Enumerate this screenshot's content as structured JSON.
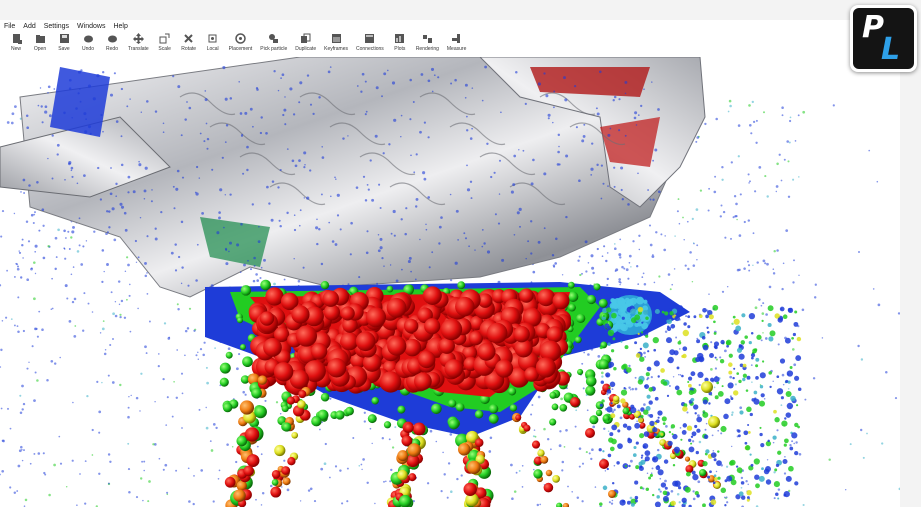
{
  "menu": [
    "File",
    "Add",
    "Settings",
    "Windows",
    "Help"
  ],
  "toolbar": [
    {
      "label": "New",
      "icon": "new-icon"
    },
    {
      "label": "Open",
      "icon": "open-icon"
    },
    {
      "label": "Save",
      "icon": "save-icon"
    },
    {
      "label": "Undo",
      "icon": "undo-icon"
    },
    {
      "label": "Redo",
      "icon": "redo-icon"
    },
    {
      "label": "Translate",
      "icon": "translate-icon"
    },
    {
      "label": "Scale",
      "icon": "scale-icon"
    },
    {
      "label": "Rotate",
      "icon": "rotate-icon"
    },
    {
      "label": "Local",
      "icon": "local-icon"
    },
    {
      "label": "Placement",
      "icon": "placement-icon"
    },
    {
      "label": "Pick particle",
      "icon": "pick-particle-icon"
    },
    {
      "label": "Duplicate",
      "icon": "duplicate-icon"
    },
    {
      "label": "Keyframes",
      "icon": "keyframes-icon"
    },
    {
      "label": "Connections",
      "icon": "connections-icon"
    },
    {
      "label": "Plots",
      "icon": "plots-icon"
    },
    {
      "label": "Rendering",
      "icon": "rendering-icon"
    },
    {
      "label": "Measure",
      "icon": "measure-icon"
    }
  ],
  "logo": {
    "letters": [
      "P",
      "L"
    ],
    "colors": {
      "p": "#ffffff",
      "l": "#2ea0e8",
      "bg": "#141414"
    }
  },
  "viewport": {
    "content": "particle-simulation-render",
    "colors": {
      "blue": "#1e3cd8",
      "green": "#22cc22",
      "red": "#e01010",
      "yellow": "#dde020",
      "orange": "#ee7a10",
      "chrome": "#c8c8cc"
    }
  }
}
